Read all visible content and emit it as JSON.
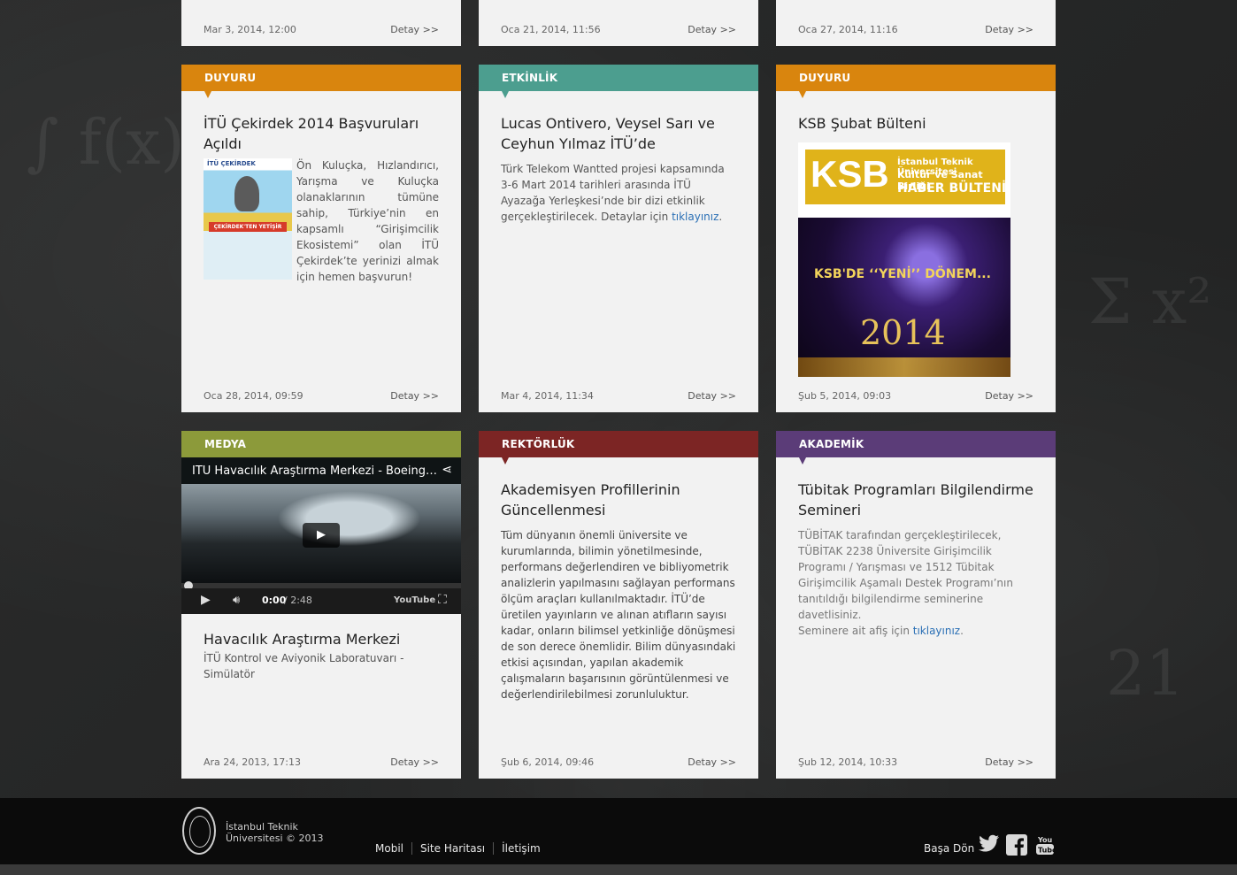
{
  "colors": {
    "duyuru": "#d9850e",
    "etkinlik": "#4c9e8f",
    "medya": "#8c9a3a",
    "rektorluk": "#7c2524",
    "akademik": "#5b3c78",
    "link": "#2a6fb5"
  },
  "detay_label": "Detay >>",
  "top_row": [
    {
      "date": "Mar 3, 2014, 12:00"
    },
    {
      "date": "Oca 21, 2014, 11:56"
    },
    {
      "date": "Oca 27, 2014, 11:16"
    }
  ],
  "row2": [
    {
      "category": "DUYURU",
      "title": "İTÜ Çekirdek 2014 Başvuruları Açıldı",
      "text": "Ön Kuluçka, Hızlandırıcı, Yarışma ve Kuluçka olanaklarının tümüne sahip, Türkiye’nin en kapsamlı “Girişimcilik Ekosistemi” olan İTÜ Çekirdek’te yerinizi almak için hemen başvurun!",
      "thumb_label": "İTÜ ÇEKİRDEK",
      "thumb_sub": "ÇEKİRDEK'TEN YETİŞİR",
      "date": "Oca 28, 2014, 09:59"
    },
    {
      "category": "ETKİNLİK",
      "title": "Lucas Ontivero, Veysel Sarı ve Ceyhun Yılmaz İTÜ’de",
      "text": "Türk Telekom Wantted projesi kapsamında 3-6 Mart 2014 tarihleri arasında İTÜ Ayazağa Yerleşkesi’nde bir dizi etkinlik gerçekleştirilecek. Detaylar için ",
      "link": "tıklayınız",
      "date": "Mar 4, 2014, 11:34"
    },
    {
      "category": "DUYURU",
      "title": "KSB Şubat Bülteni",
      "ksb_big": "KSB",
      "ksb_line1": "İstanbul Teknik Üniversitesi",
      "ksb_line2": "Kültür ve Sanat Birliği",
      "ksb_line3": "HABER BÜLTENİ",
      "ksb_banner": "KSB'DE ‘‘YENİ’’ DÖNEM...",
      "ksb_year": "2014",
      "date": "Şub 5, 2014, 09:03"
    }
  ],
  "row3": [
    {
      "category": "MEDYA",
      "video_title": "İTÜ Havacılık Araştırma Merkezi - Boeing Simülatörü",
      "video_time": "0:00",
      "video_duration": "/ 2:48",
      "youtube_label": "YouTube",
      "title": "Havacılık Araştırma Merkezi",
      "text": "İTÜ Kontrol ve Aviyonik Laboratuvarı - Simülatör",
      "date": "Ara 24, 2013, 17:13"
    },
    {
      "category": "REKTÖRLÜK",
      "title": "Akademisyen Profillerinin Güncellenmesi",
      "text": "Tüm dünyanın önemli üniversite ve kurumlarında, bilimin yönetilmesinde, performans değerlendiren ve bibliyometrik analizlerin yapılmasını sağlayan performans ölçüm araçları kullanılmaktadır. İTÜ’de  üretilen yayınların ve alınan atıfların sayısı kadar, onların bilimsel yetkinliğe dönüşmesi de son derece önemlidir. Bilim dünyasındaki etkisi açısından, yapılan akademik çalışmaların başarısının görüntülenmesi ve değerlendirilebilmesi zorunluluktur.",
      "date": "Şub 6, 2014, 09:46"
    },
    {
      "category": "AKADEMİK",
      "title": "Tübitak Programları Bilgilendirme Semineri",
      "text": "TÜBİTAK tarafından gerçekleştirilecek, TÜBİTAK 2238 Üniversite  Girişimcilik Programı / Yarışması ve 1512 Tübitak Girişimcilik Aşamalı Destek Programı’nın tanıtıldığı  bilgilendirme seminerine davetlisiniz.",
      "text2": "Seminere ait afiş için ",
      "link": "tıklayınız",
      "date": "Şub 12, 2014, 10:33"
    }
  ],
  "footer": {
    "org_line1": "İstanbul Teknik",
    "org_line2": "Üniversitesi © 2013",
    "links": [
      "Mobil",
      "Site Haritası",
      "İletişim"
    ],
    "back_to_top": "Başa Dön",
    "social": [
      "twitter-icon",
      "facebook-icon",
      "youtube-icon"
    ]
  }
}
